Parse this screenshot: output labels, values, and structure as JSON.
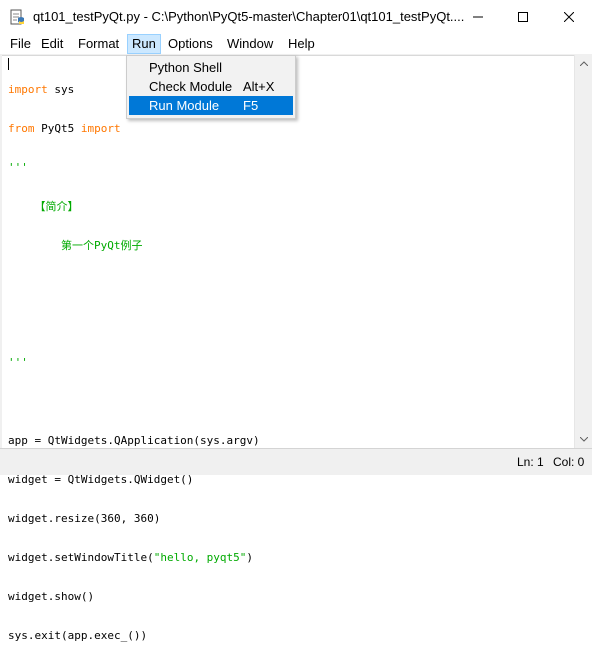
{
  "window": {
    "title": "qt101_testPyQt.py - C:\\Python\\PyQt5-master\\Chapter01\\qt101_testPyQt...."
  },
  "menu": {
    "items": [
      {
        "label": "File"
      },
      {
        "label": "Edit"
      },
      {
        "label": "Format"
      },
      {
        "label": "Run"
      },
      {
        "label": "Options"
      },
      {
        "label": "Window"
      },
      {
        "label": "Help"
      }
    ]
  },
  "run_menu": {
    "items": [
      {
        "label": "Python Shell",
        "accel": ""
      },
      {
        "label": "Check Module",
        "accel": "Alt+X"
      },
      {
        "label": "Run Module",
        "accel": "F5"
      }
    ]
  },
  "code": {
    "l1_kw": "import",
    "l1_rest": " sys",
    "l2_kw": "from",
    "l2_mid": " PyQt5 ",
    "l2_kw2": "import",
    "l3": "'''",
    "l4": "    【简介】",
    "l5": "        第一个PyQt例子",
    "l6": "",
    "l7": "",
    "l8": "'''",
    "l9": "",
    "l10": "app = QtWidgets.QApplication(sys.argv)",
    "l11": "widget = QtWidgets.QWidget()",
    "l12": "widget.resize(360, 360)",
    "l13_a": "widget.setWindowTitle(",
    "l13_s": "\"hello, pyqt5\"",
    "l13_b": ")",
    "l14": "widget.show()",
    "l15": "sys.exit(app.exec_())"
  },
  "status": {
    "line": "Ln: 1",
    "col": "Col: 0"
  },
  "colors": {
    "keyword": "#ff7700",
    "string": "#00aa00",
    "menu_highlight": "#0078d7"
  },
  "icons": [
    "idle-python-icon",
    "minimize-icon",
    "maximize-icon",
    "close-icon",
    "scroll-up-icon",
    "scroll-down-icon"
  ]
}
